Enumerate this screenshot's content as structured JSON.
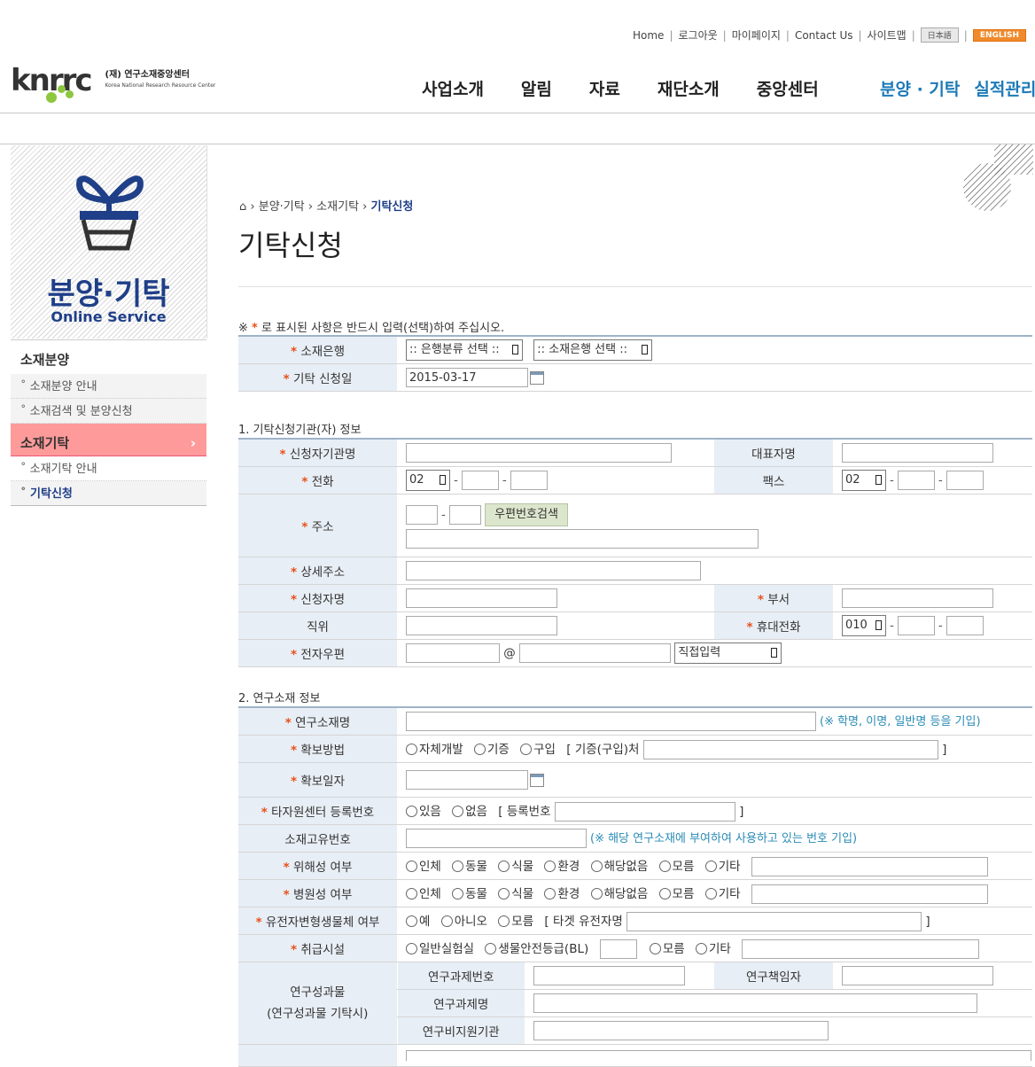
{
  "header": {
    "utility": [
      "Home",
      "로그아웃",
      "마이페이지",
      "Contact Us",
      "사이트맵"
    ],
    "lang_jp": "日本語",
    "lang_en": "ENGLISH",
    "logo_mark": "knrrc",
    "logo_korean": "(재) 연구소재중앙센터",
    "logo_english": "Korea National Research Resource Center",
    "gnb": [
      "사업소개",
      "알림",
      "자료",
      "재단소개",
      "중앙센터"
    ],
    "gnb_right": [
      "분양 · 기탁",
      "실적관리"
    ]
  },
  "sidebar": {
    "title": "분양·기탁",
    "subtitle": "Online Service",
    "group1": "소재분양",
    "group1_items": [
      "소재분양 안내",
      "소재검색 및 분양신청"
    ],
    "group2": "소재기탁",
    "group2_arrow": "›",
    "group2_items": [
      "소재기탁 안내",
      "기탁신청"
    ]
  },
  "breadcrumb": {
    "home_icon": "home-icon",
    "l1": "분양·기탁",
    "l2": "소재기탁",
    "current": "기탁신청"
  },
  "page_title": "기탁신청",
  "required_note": "로 표시된 사항은 반드시 입력(선택)하여 주십시오.",
  "required_note_prefix": "※",
  "star": "*",
  "top_form": {
    "bank_label": "소재은행",
    "bank_cat": ":: 은행분류 선택 ::",
    "bank_sel": ":: 소재은행 선택 ::",
    "date_label": "기탁 신청일",
    "date_value": "2015-03-17"
  },
  "section1": {
    "title": "1. 기탁신청기관(자) 정보",
    "org": "신청자기관명",
    "rep": "대표자명",
    "phone": "전화",
    "phone_code": "02",
    "fax": "팩스",
    "fax_code": "02",
    "address": "주소",
    "zip_button": "우편번호검색",
    "detail_address": "상세주소",
    "applicant": "신청자명",
    "dept": "부서",
    "position": "직위",
    "mobile": "휴대전화",
    "mobile_code": "010",
    "email": "전자우편",
    "at": "@",
    "email_domain": "직접입력"
  },
  "section2": {
    "title": "2. 연구소재 정보",
    "name": "연구소재명",
    "name_hint": "(※ 학명, 이명, 일반명 등을 기입)",
    "method": "확보방법",
    "method_opts": [
      "자체개발",
      "기증",
      "구입"
    ],
    "method_source": "[ 기증(구입)처",
    "close_bracket": "]",
    "date": "확보일자",
    "other_reg": "타자원센터 등록번호",
    "yes": "있음",
    "no": "없음",
    "reg_no": "[ 등록번호",
    "unique_no": "소재고유번호",
    "unique_hint": "(※ 해당 연구소재에 부여하여 사용하고 있는 번호 기입)",
    "hazard": "위해성 여부",
    "pathogen": "병원성 여부",
    "risk_opts": [
      "인체",
      "동물",
      "식물",
      "환경",
      "해당없음",
      "모름",
      "기타"
    ],
    "gmo": "유전자변형생물체 여부",
    "gmo_opts": [
      "예",
      "아니오",
      "모름"
    ],
    "gmo_target": "[ 타겟 유전자명",
    "facility": "취급시설",
    "facility_opts": [
      "일반실험실",
      "생물안전등급(BL)"
    ],
    "facility_unknown": "모름",
    "facility_other": "기타",
    "research_label1": "연구성과물",
    "research_label2": "(연구성과물 기탁시)",
    "project_no": "연구과제번호",
    "pi": "연구책임자",
    "project_name": "연구과제명",
    "funding": "연구비지원기관"
  }
}
